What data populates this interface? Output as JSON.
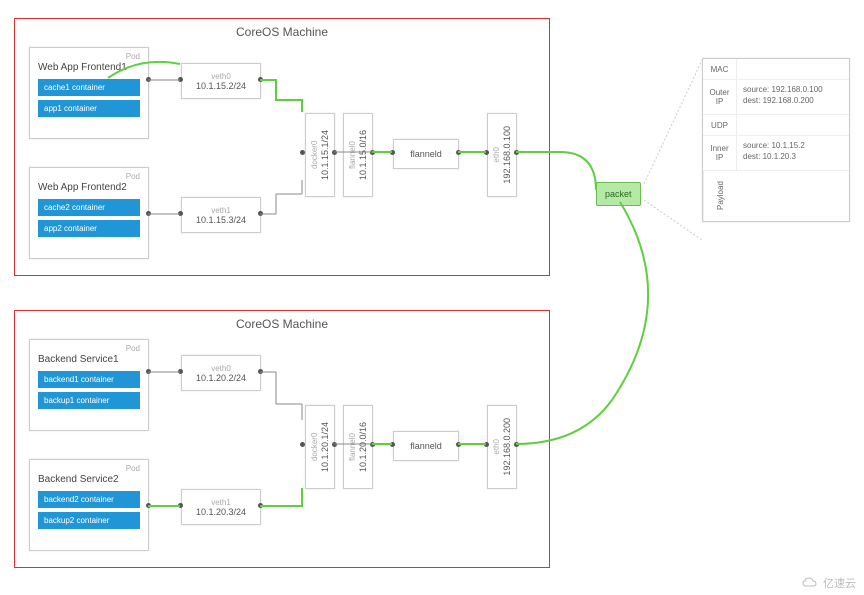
{
  "machines": [
    {
      "title": "CoreOS Machine",
      "pods": [
        {
          "label": "Pod",
          "title": "Web App Frontend1",
          "containers": [
            "cache1 container",
            "app1 container"
          ]
        },
        {
          "label": "Pod",
          "title": "Web App Frontend2",
          "containers": [
            "cache2 container",
            "app2 container"
          ]
        }
      ],
      "veths": [
        {
          "name": "veth0",
          "ip": "10.1.15.2/24"
        },
        {
          "name": "veth1",
          "ip": "10.1.15.3/24"
        }
      ],
      "docker0": {
        "name": "docker0",
        "ip": "10.1.15.1/24"
      },
      "flannel0": {
        "name": "flannel0",
        "ip": "10.1.15.0/16"
      },
      "flanneld": "flanneld",
      "eth0": {
        "name": "eth0",
        "ip": "192.168.0.100"
      }
    },
    {
      "title": "CoreOS Machine",
      "pods": [
        {
          "label": "Pod",
          "title": "Backend Service1",
          "containers": [
            "backend1 container",
            "backup1 container"
          ]
        },
        {
          "label": "Pod",
          "title": "Backend Service2",
          "containers": [
            "backend2 container",
            "backup2 container"
          ]
        }
      ],
      "veths": [
        {
          "name": "veth0",
          "ip": "10.1.20.2/24"
        },
        {
          "name": "veth1",
          "ip": "10.1.20.3/24"
        }
      ],
      "docker0": {
        "name": "docker0",
        "ip": "10.1.20.1/24"
      },
      "flannel0": {
        "name": "flannel0",
        "ip": "10.1.20.0/16"
      },
      "flanneld": "flanneld",
      "eth0": {
        "name": "eth0",
        "ip": "192.168.0.200"
      }
    }
  ],
  "packet": {
    "label": "packet",
    "rows": [
      {
        "hdr": "MAC",
        "body": ""
      },
      {
        "hdr": "Outer IP",
        "body": "source: 192.168.0.100\ndest: 192.168.0.200"
      },
      {
        "hdr": "UDP",
        "body": ""
      },
      {
        "hdr": "Inner IP",
        "body": "source: 10.1.15.2\ndest: 10.1.20.3"
      },
      {
        "hdr": "Payload",
        "body": ""
      }
    ]
  },
  "watermark": "亿速云"
}
